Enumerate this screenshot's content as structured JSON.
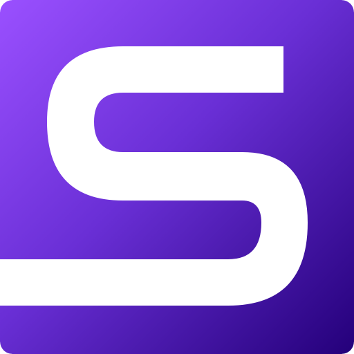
{
  "icon": {
    "name": "s-logo-icon",
    "colors": {
      "gradient_start": "#9a50ff",
      "gradient_mid": "#6a2fd6",
      "gradient_end": "#24007a",
      "glyph": "#ffffff"
    }
  }
}
